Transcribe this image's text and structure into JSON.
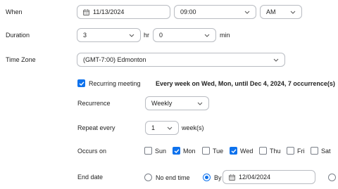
{
  "when": {
    "label": "When",
    "date": "11/13/2024",
    "time": "09:00",
    "ampm": "AM"
  },
  "duration": {
    "label": "Duration",
    "hours": "3",
    "hours_unit": "hr",
    "minutes": "0",
    "minutes_unit": "min"
  },
  "timezone": {
    "label": "Time Zone",
    "value": "(GMT-7:00) Edmonton"
  },
  "recurring": {
    "checkbox_label": "Recurring meeting",
    "checked": true,
    "summary": "Every week on Wed, Mon, until Dec 4, 2024, 7 occurrence(s)"
  },
  "recurrence": {
    "label": "Recurrence",
    "value": "Weekly"
  },
  "repeat_every": {
    "label": "Repeat every",
    "value": "1",
    "unit": "week(s)"
  },
  "occurs_on": {
    "label": "Occurs on",
    "days": [
      {
        "label": "Sun",
        "checked": false
      },
      {
        "label": "Mon",
        "checked": true
      },
      {
        "label": "Tue",
        "checked": false
      },
      {
        "label": "Wed",
        "checked": true
      },
      {
        "label": "Thu",
        "checked": false
      },
      {
        "label": "Fri",
        "checked": false
      },
      {
        "label": "Sat",
        "checked": false
      }
    ]
  },
  "end_date": {
    "label": "End date",
    "no_end_label": "No end time",
    "by_label": "By",
    "by_date": "12/04/2024",
    "selected": "by"
  },
  "colors": {
    "accent": "#0e72ed",
    "border": "#b9bcc2",
    "text": "#222222"
  }
}
